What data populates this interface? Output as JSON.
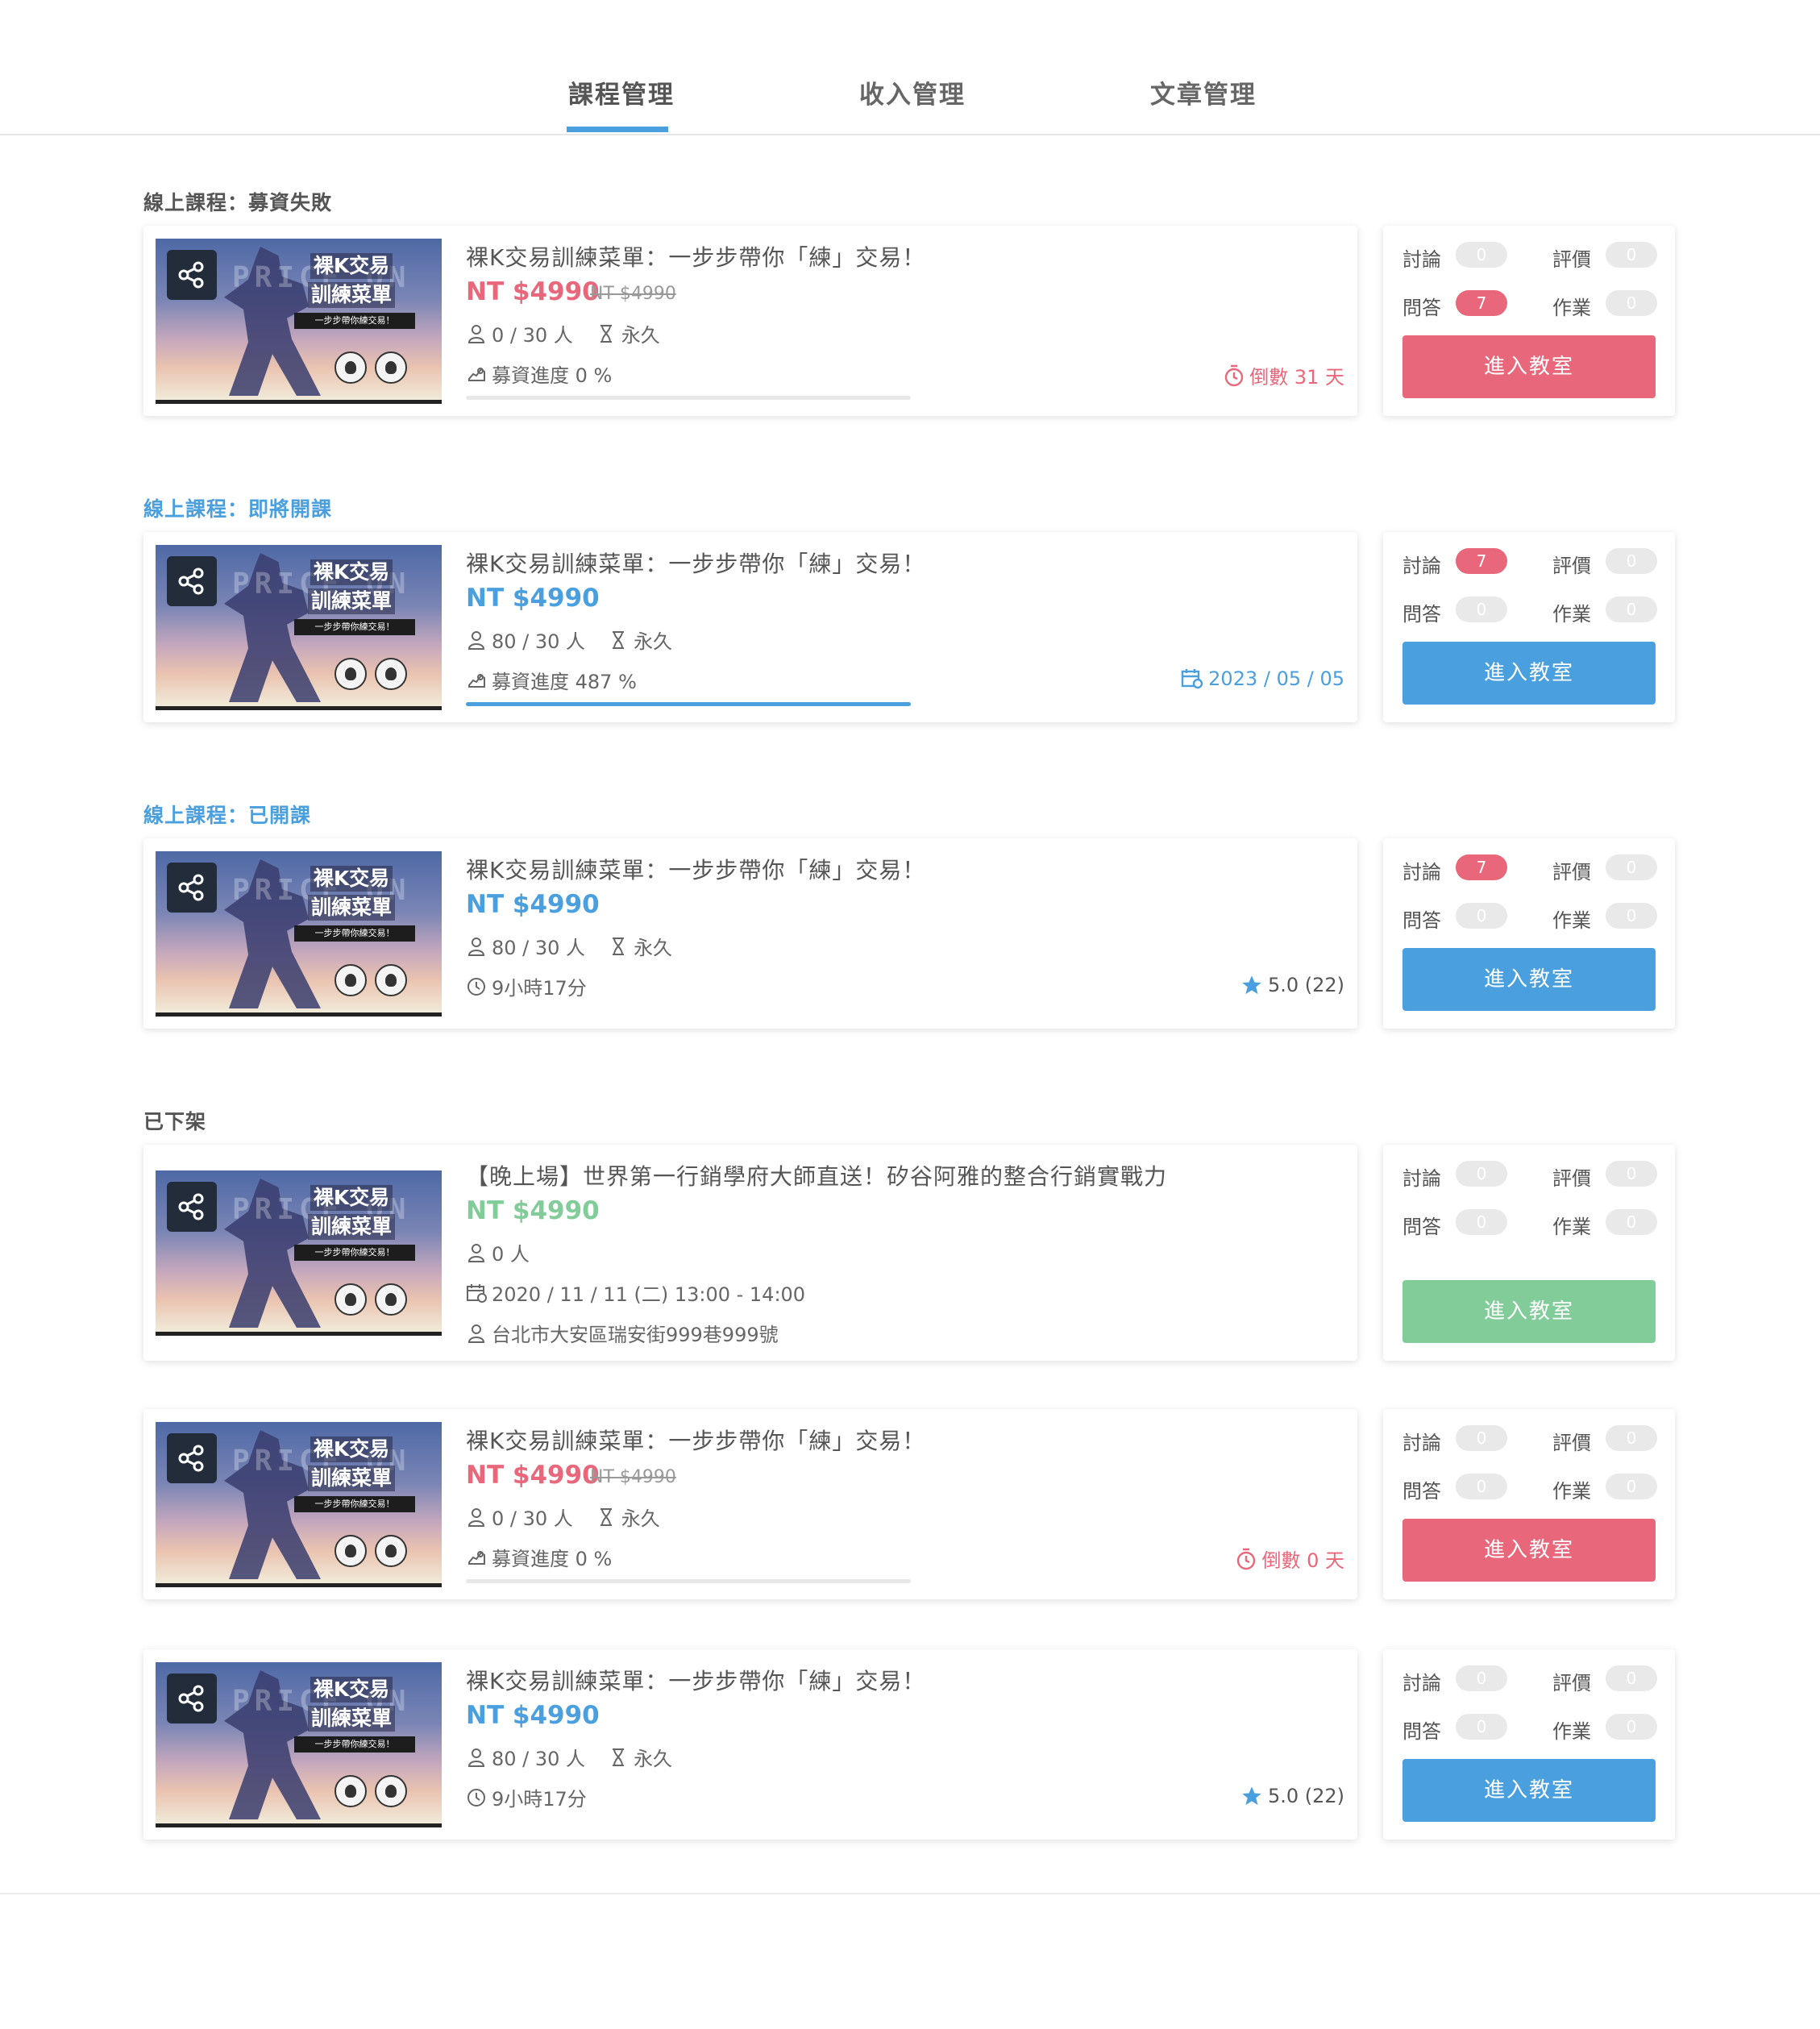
{
  "tabs": [
    "課程管理",
    "收入管理",
    "文章管理"
  ],
  "colors": {
    "accent": "#4a9fdf",
    "danger": "#e8677a",
    "success": "#82cc9a",
    "muted": "#e9e9e9"
  },
  "stat_labels": {
    "discuss": "討論",
    "review": "評價",
    "qa": "問答",
    "homework": "作業"
  },
  "enter_label": "進入教室",
  "thumbnail": {
    "bg_word_top": "PRICE ON",
    "line1": "裸K交易",
    "line2": "訓練菜單",
    "sub": "一步步帶你練交易！"
  },
  "sections": [
    {
      "label": "線上課程：募資失敗",
      "label_color": "#555555",
      "card": {
        "title": "裸K交易訓練菜單：一步步帶你「練」交易！",
        "price": "NT $4990",
        "price_color": "#e8677a",
        "old_price": "NT $4990",
        "students": "0 / 30 人",
        "duration": "永久",
        "progress_text": "募資進度 0 %",
        "progress": 0,
        "right_text": "倒數 31 天",
        "right_color": "#e8677a",
        "right_icon": "timer-icon"
      },
      "stats": {
        "discuss": "0",
        "review": "0",
        "qa": "7",
        "homework": "0"
      },
      "hot": [
        "qa"
      ],
      "button_color": "#e8677a"
    },
    {
      "label": "線上課程：即將開課",
      "label_color": "#4a9fdf",
      "card": {
        "title": "裸K交易訓練菜單：一步步帶你「練」交易！",
        "price": "NT $4990",
        "price_color": "#4a9fdf",
        "students": "80 / 30 人",
        "duration": "永久",
        "progress_text": "募資進度 487 %",
        "progress": 1,
        "right_text": "2023 / 05 / 05",
        "right_color": "#4a9fdf",
        "right_icon": "calendar-icon"
      },
      "stats": {
        "discuss": "7",
        "review": "0",
        "qa": "0",
        "homework": "0"
      },
      "hot": [
        "discuss"
      ],
      "button_color": "#4a9fdf"
    },
    {
      "label": "線上課程：已開課",
      "label_color": "#4a9fdf",
      "card": {
        "title": "裸K交易訓練菜單：一步步帶你「練」交易！",
        "price": "NT $4990",
        "price_color": "#4a9fdf",
        "students": "80 / 30 人",
        "duration": "永久",
        "length": "9小時17分",
        "right_text": "5.0 (22)",
        "right_color": "#555555",
        "right_icon": "star-icon"
      },
      "stats": {
        "discuss": "7",
        "review": "0",
        "qa": "0",
        "homework": "0"
      },
      "hot": [
        "discuss"
      ],
      "button_color": "#4a9fdf"
    },
    {
      "label": "已下架",
      "label_color": "#555555",
      "card": {
        "title": "【晚上場】世界第一行銷學府大師直送！矽谷阿雅的整合行銷實戰力",
        "price": "NT $4990",
        "price_color": "#82cc9a",
        "students": "0 人",
        "datetime": "2020 / 11 / 11 (二) 13:00 - 14:00",
        "location": "台北市大安區瑞安街999巷999號"
      },
      "stats": {
        "discuss": "0",
        "review": "0",
        "qa": "0",
        "homework": "0"
      },
      "hot": [],
      "button_color": "#82cc9a"
    },
    {
      "label": "",
      "card": {
        "title": "裸K交易訓練菜單：一步步帶你「練」交易！",
        "price": "NT $4990",
        "price_color": "#e8677a",
        "old_price": "NT $4990",
        "students": "0 / 30 人",
        "duration": "永久",
        "progress_text": "募資進度 0 %",
        "progress": 0,
        "right_text": "倒數 0 天",
        "right_color": "#e8677a",
        "right_icon": "timer-icon"
      },
      "stats": {
        "discuss": "0",
        "review": "0",
        "qa": "0",
        "homework": "0"
      },
      "hot": [],
      "button_color": "#e8677a"
    },
    {
      "label": "",
      "card": {
        "title": "裸K交易訓練菜單：一步步帶你「練」交易！",
        "price": "NT $4990",
        "price_color": "#4a9fdf",
        "students": "80 / 30 人",
        "duration": "永久",
        "length": "9小時17分",
        "right_text": "5.0 (22)",
        "right_color": "#555555",
        "right_icon": "star-icon"
      },
      "stats": {
        "discuss": "0",
        "review": "0",
        "qa": "0",
        "homework": "0"
      },
      "hot": [],
      "button_color": "#4a9fdf"
    }
  ]
}
